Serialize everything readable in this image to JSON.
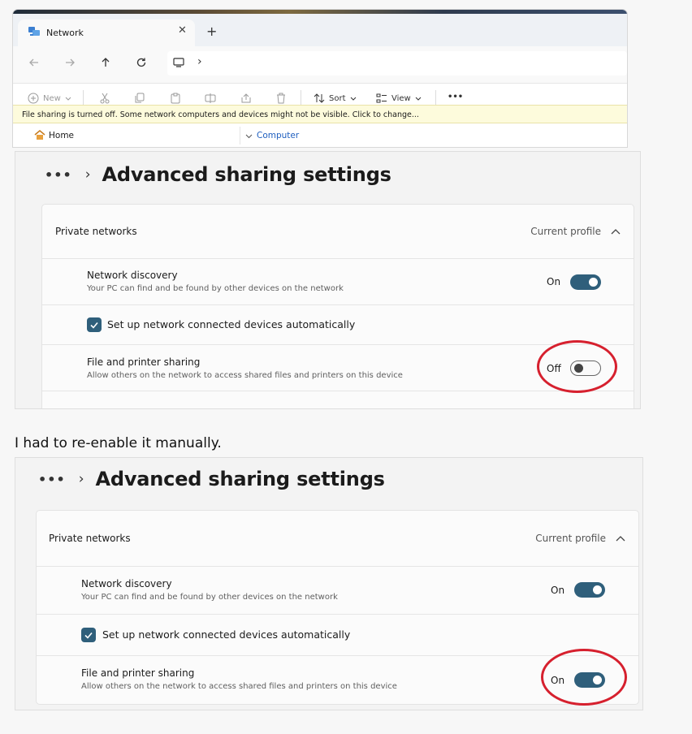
{
  "explorer": {
    "tab_title": "Network",
    "tab_close": "✕",
    "new_tab": "+",
    "address_chevron": "›",
    "toolbar": {
      "new": "New",
      "sort": "Sort",
      "view": "View",
      "more": "•••"
    },
    "info_bar": "File sharing is turned off. Some network computers and devices might not be visible. Click to change...",
    "home_label": "Home",
    "computer_label": "Computer",
    "icons": [
      "network-icon",
      "back-arrow-icon",
      "forward-arrow-icon",
      "up-arrow-icon",
      "refresh-icon",
      "computer-icon",
      "plus-circle-icon",
      "cut-icon",
      "copy-icon",
      "paste-icon",
      "rename-icon",
      "share-icon",
      "delete-icon",
      "sort-icon",
      "view-icon",
      "more-icon",
      "home-icon",
      "chevron-down-icon"
    ]
  },
  "settings_before": {
    "breadcrumb_dots": "•••",
    "breadcrumb_chevron": "›",
    "page_title": "Advanced sharing settings",
    "section_title": "Private networks",
    "section_tag": "Current profile",
    "network_discovery": {
      "title": "Network discovery",
      "description": "Your PC can find and be found by other devices on the network",
      "state": "On"
    },
    "auto_setup_label": "Set up network connected devices automatically",
    "auto_setup_checked": true,
    "file_sharing": {
      "title": "File and printer sharing",
      "description": "Allow others on the network to access shared files and printers on this device",
      "state": "Off"
    }
  },
  "caption": "I had to re-enable it manually.",
  "settings_after": {
    "breadcrumb_dots": "•••",
    "breadcrumb_chevron": "›",
    "page_title": "Advanced sharing settings",
    "section_title": "Private networks",
    "section_tag": "Current profile",
    "network_discovery": {
      "title": "Network discovery",
      "description": "Your PC can find and be found by other devices on the network",
      "state": "On"
    },
    "auto_setup_label": "Set up network connected devices automatically",
    "auto_setup_checked": true,
    "file_sharing": {
      "title": "File and printer sharing",
      "description": "Allow others on the network to access shared files and printers on this device",
      "state": "On"
    }
  },
  "colors": {
    "accent": "#2f5f7b",
    "highlight_ring": "#d6202e",
    "info_bar": "#fdfbdc"
  }
}
